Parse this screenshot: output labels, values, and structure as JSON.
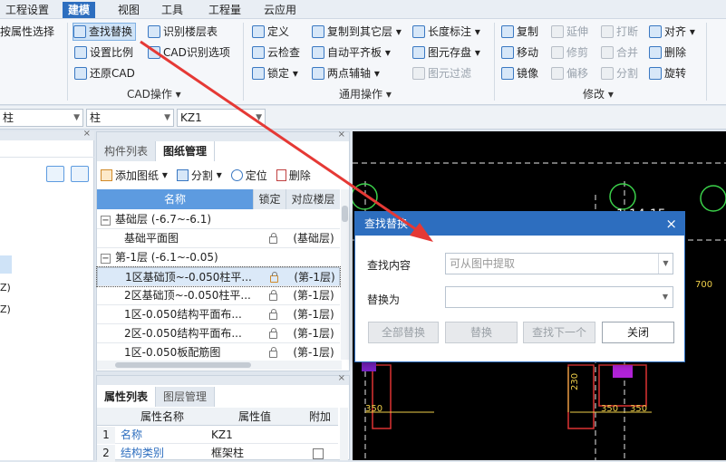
{
  "menu": {
    "items": [
      "工程设置",
      "建模",
      "视图",
      "工具",
      "工程量",
      "云应用"
    ],
    "active": "建模"
  },
  "ribbon": {
    "col0": {
      "item0": "按属性选择"
    },
    "cad": {
      "find_replace": "查找替换",
      "set_scale": "设置比例",
      "restore_cad": "还原CAD",
      "identify_floor_table": "识别楼层表",
      "cad_options": "CAD识别选项",
      "group_label": "CAD操作"
    },
    "common": {
      "define": "定义",
      "cloud_check": "云检查",
      "lock": "锁定",
      "copy_to_floor": "复制到其它层",
      "auto_align_slab": "自动平齐板",
      "two_point_axis": "两点辅轴",
      "length_mark": "长度标注",
      "save_element": "图元存盘",
      "filter_element": "图元过滤",
      "group_label": "通用操作"
    },
    "modify": {
      "copy": "复制",
      "extend": "延伸",
      "break": "打断",
      "align": "对齐",
      "move": "移动",
      "trim": "修剪",
      "merge": "合并",
      "delete": "删除",
      "mirror": "镜像",
      "offset": "偏移",
      "split": "分割",
      "rotate": "旋转",
      "group_label": "修改"
    }
  },
  "selectors": {
    "s1": "柱",
    "s2": "柱",
    "s3": "KZ1"
  },
  "left_pane": {
    "z1": "Z)",
    "z2": "Z)"
  },
  "component_panel": {
    "tabs": [
      "构件列表",
      "图纸管理"
    ],
    "active_tab": "图纸管理",
    "toolbar": {
      "add": "添加图纸",
      "split": "分割",
      "locate": "定位",
      "delete": "删除"
    },
    "columns": [
      "名称",
      "锁定",
      "对应楼层"
    ],
    "rows": [
      {
        "name": "基础层 (-6.7~-6.1)",
        "group": true,
        "floor": ""
      },
      {
        "name": "基础平面图",
        "group": false,
        "floor": "(基础层)"
      },
      {
        "name": "第-1层 (-6.1~-0.05)",
        "group": true,
        "floor": ""
      },
      {
        "name": "1区基础顶~-0.050柱平...",
        "group": false,
        "floor": "(第-1层)",
        "selected": true
      },
      {
        "name": "2区基础顶~-0.050柱平...",
        "group": false,
        "floor": "(第-1层)"
      },
      {
        "name": "1区-0.050结构平面布...",
        "group": false,
        "floor": "(第-1层)"
      },
      {
        "name": "2区-0.050结构平面布...",
        "group": false,
        "floor": "(第-1层)"
      },
      {
        "name": "1区-0.050板配筋图",
        "group": false,
        "floor": "(第-1层)"
      }
    ]
  },
  "prop_panel": {
    "tabs": [
      "属性列表",
      "图层管理"
    ],
    "active_tab": "属性列表",
    "columns": [
      "属性名称",
      "属性值",
      "附加"
    ],
    "rows": [
      {
        "idx": "1",
        "name": "名称",
        "value": "KZ1"
      },
      {
        "idx": "2",
        "name": "结构类别",
        "value": "框架柱"
      }
    ]
  },
  "cad": {
    "label_350": "350",
    "label_230": "230",
    "label_700": "700",
    "label_frag": "-1-14-15"
  },
  "dialog": {
    "title": "查找替换",
    "find_label": "查找内容",
    "find_placeholder": "可从图中提取",
    "replace_label": "替换为",
    "buttons": {
      "replace_all": "全部替换",
      "replace": "替换",
      "find_next": "查找下一个",
      "close": "关闭"
    }
  },
  "colors": {
    "accent": "#2d6ebf",
    "table_header": "#5d9be0",
    "arrow": "#e53935",
    "cad_bg": "#000000"
  }
}
